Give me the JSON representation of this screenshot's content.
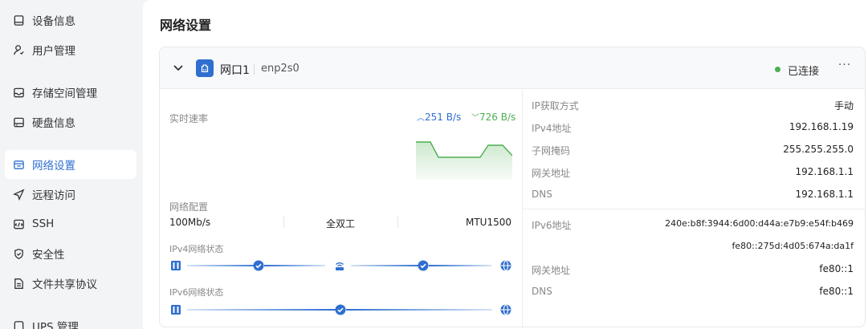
{
  "sidebar": {
    "items": [
      {
        "label": "设备信息",
        "icon": "device-icon",
        "active": false
      },
      {
        "label": "用户管理",
        "icon": "user-icon",
        "active": false
      },
      {
        "label": "存储空间管理",
        "icon": "storage-icon",
        "active": false
      },
      {
        "label": "硬盘信息",
        "icon": "disk-icon",
        "active": false
      },
      {
        "label": "网络设置",
        "icon": "network-icon",
        "active": true
      },
      {
        "label": "远程访问",
        "icon": "remote-icon",
        "active": false
      },
      {
        "label": "SSH",
        "icon": "ssh-icon",
        "active": false
      },
      {
        "label": "安全性",
        "icon": "shield-icon",
        "active": false
      },
      {
        "label": "文件共享协议",
        "icon": "file-share-icon",
        "active": false
      },
      {
        "label": "UPS 管理",
        "icon": "ups-icon",
        "active": false
      }
    ]
  },
  "main": {
    "title": "网络设置",
    "card": {
      "port_name": "网口1",
      "device": "enp2s0",
      "status": "已连接",
      "more": "···",
      "speed": {
        "label": "实时速率",
        "up": "251 B/s",
        "down": "726 B/s"
      },
      "config": {
        "label": "网络配置",
        "speed": "100Mb/s",
        "duplex": "全双工",
        "mtu": "MTU1500"
      },
      "ipv4_status_label": "IPv4网络状态",
      "ipv6_status_label": "IPv6网络状态",
      "ipv4": [
        {
          "label": "IP获取方式",
          "value": "手动"
        },
        {
          "label": "IPv4地址",
          "value": "192.168.1.19"
        },
        {
          "label": "子网掩码",
          "value": "255.255.255.0"
        },
        {
          "label": "网关地址",
          "value": "192.168.1.1"
        },
        {
          "label": "DNS",
          "value": "192.168.1.1"
        }
      ],
      "ipv6": {
        "address_label": "IPv6地址",
        "addresses": [
          "240e:b8f:3944:6d00:d44a:e7b9:e54f:b469",
          "fe80::275d:4d05:674a:da1f"
        ],
        "gateway_label": "网关地址",
        "gateway": "fe80::1",
        "dns_label": "DNS",
        "dns": "fe80::1"
      }
    }
  },
  "colors": {
    "accent": "#2f6fd0",
    "success": "#4caf50",
    "muted": "#888888"
  }
}
